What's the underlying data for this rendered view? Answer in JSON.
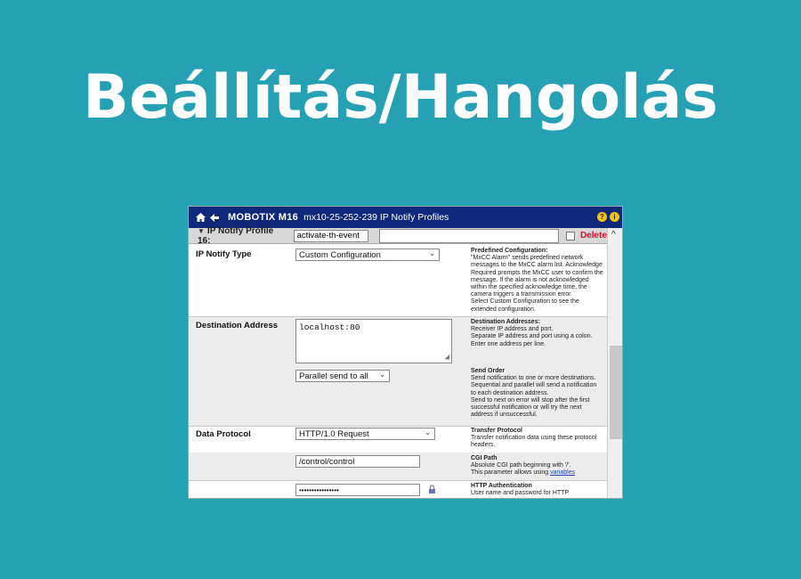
{
  "heading": "Beállítás/Hangolás",
  "window": {
    "brand": "MOBOTIX M16",
    "address": "mx10-25-252-239 IP Notify Profiles",
    "icons": [
      "home-icon",
      "back-icon",
      "help-icon",
      "info-icon"
    ]
  },
  "profile_bar": {
    "label": "IP Notify Profile 16:",
    "name_value": "activate-th-event",
    "delete_label": "Delete"
  },
  "sections": {
    "notify_type": {
      "label": "IP Notify Type",
      "select_value": "Custom Configuration",
      "help_title": "Predefined Configuration:",
      "help_lines": [
        "\"MxCC Alarm\" sends predefined network",
        "messages to the MxCC alarm list. Acknowledge",
        "Required prompts the MxCC user to confirm the",
        "message. If the alarm is not acknowledged",
        "within the specified acknowledge time, the",
        "camera triggers a transmission error.",
        "Select Custom Configuration to see the",
        "extended configuration."
      ]
    },
    "destination": {
      "label": "Destination Address",
      "textarea_value": "localhost:80",
      "help_title": "Destination Addresses:",
      "help_lines": [
        "Receiver IP address and port.",
        "Separate IP address and port using a colon.",
        "Enter one address per line."
      ],
      "send_order_value": "Parallel send to all",
      "send_help_title": "Send Order",
      "send_help_lines": [
        "Send notification to one or more destinations.",
        "Sequential and parallel will send a notification",
        "to each destination address.",
        "Send to next on error will stop after the first",
        "successful notification or will try the next",
        "address if unsuccessful."
      ]
    },
    "protocol": {
      "label": "Data Protocol",
      "select_value": "HTTP/1.0 Request",
      "help_title": "Transfer Protocol",
      "help_lines": [
        "Transfer notification data using these protocol",
        "headers."
      ],
      "cgi_value": "/control/control",
      "cgi_help_title": "CGI Path",
      "cgi_help_lines": [
        "Absolute CGI path beginning with '/'.",
        "This parameter allows using"
      ],
      "cgi_help_link": "variables",
      "password_value": "••••••••••••••••",
      "auth_help_title": "HTTP Authentication",
      "auth_help_lines": [
        "User name and password for HTTP"
      ]
    }
  },
  "colors": {
    "background": "#26a1b4",
    "title_bar": "#10287a",
    "delete": "#e0102a",
    "section_gray": "#ececec"
  }
}
